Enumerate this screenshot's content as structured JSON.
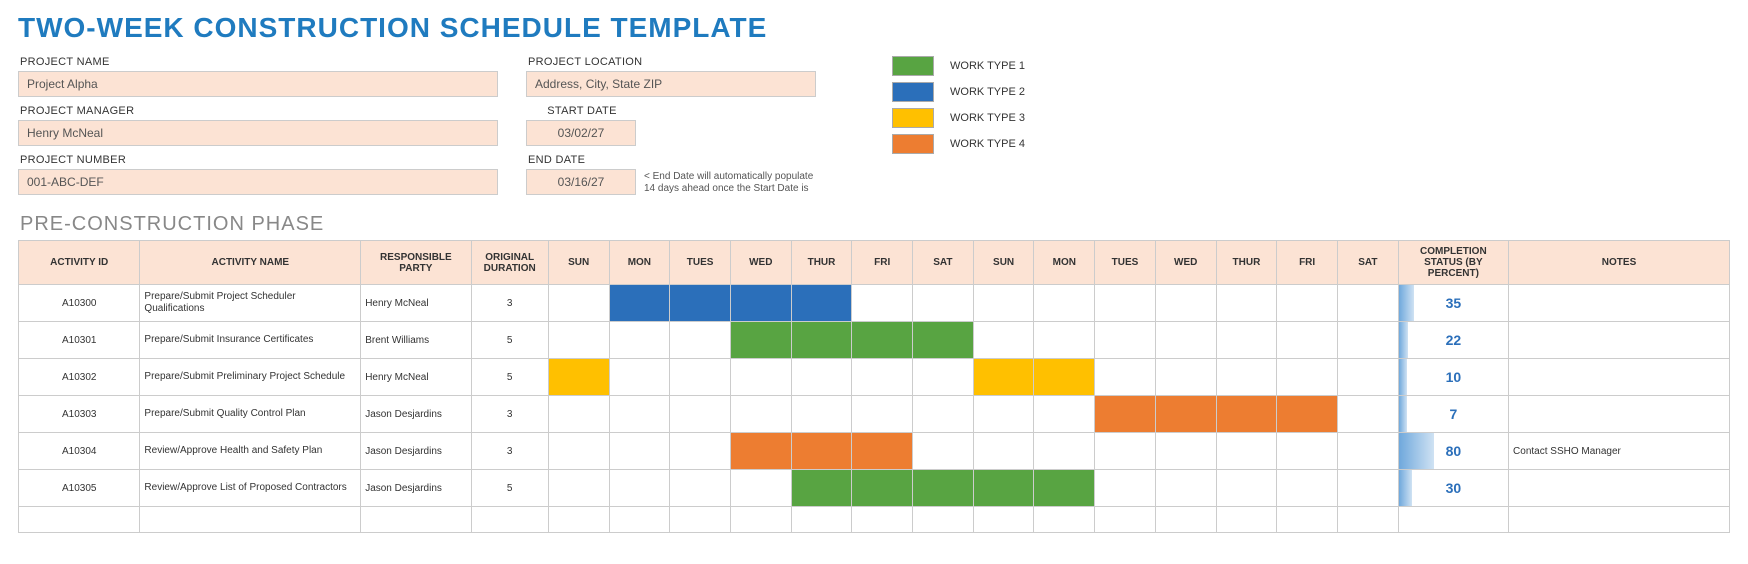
{
  "title": "TWO-WEEK CONSTRUCTION SCHEDULE TEMPLATE",
  "meta": {
    "project_name_label": "PROJECT NAME",
    "project_name": "Project Alpha",
    "project_manager_label": "PROJECT MANAGER",
    "project_manager": "Henry McNeal",
    "project_number_label": "PROJECT NUMBER",
    "project_number": "001-ABC-DEF",
    "project_location_label": "PROJECT LOCATION",
    "project_location": "Address, City, State ZIP",
    "start_date_label": "START DATE",
    "start_date": "03/02/27",
    "end_date_label": "END DATE",
    "end_date": "03/16/27",
    "end_date_hint": "< End Date will automatically populate 14 days ahead once the Start Date is"
  },
  "legend": [
    {
      "label": "WORK TYPE 1",
      "color": "#58a442"
    },
    {
      "label": "WORK TYPE 2",
      "color": "#2b6fba"
    },
    {
      "label": "WORK TYPE 3",
      "color": "#ffc000"
    },
    {
      "label": "WORK TYPE 4",
      "color": "#ed7d31"
    }
  ],
  "section_title": "PRE-CONSTRUCTION PHASE",
  "columns": {
    "activity_id": "ACTIVITY ID",
    "activity_name": "ACTIVITY NAME",
    "responsible_party": "RESPONSIBLE PARTY",
    "original_duration": "ORIGINAL DURATION",
    "days": [
      "SUN",
      "MON",
      "TUES",
      "WED",
      "THUR",
      "FRI",
      "SAT",
      "SUN",
      "MON",
      "TUES",
      "WED",
      "THUR",
      "FRI",
      "SAT"
    ],
    "completion": "COMPLETION STATUS (BY PERCENT)",
    "notes": "NOTES"
  },
  "rows": [
    {
      "id": "A10300",
      "name": "Prepare/Submit Project Scheduler Qualifications",
      "responsible": "Henry McNeal",
      "duration": "3",
      "fills": [
        "",
        "blue",
        "blue",
        "blue",
        "blue",
        "",
        "",
        "",
        "",
        "",
        "",
        "",
        "",
        ""
      ],
      "completion": 35,
      "notes": ""
    },
    {
      "id": "A10301",
      "name": "Prepare/Submit Insurance Certificates",
      "responsible": "Brent Williams",
      "duration": "5",
      "fills": [
        "",
        "",
        "",
        "green",
        "green",
        "green",
        "green",
        "",
        "",
        "",
        "",
        "",
        "",
        ""
      ],
      "completion": 22,
      "notes": ""
    },
    {
      "id": "A10302",
      "name": "Prepare/Submit Preliminary Project Schedule",
      "responsible": "Henry McNeal",
      "duration": "5",
      "fills": [
        "yellow",
        "",
        "",
        "",
        "",
        "",
        "",
        "yellow",
        "yellow",
        "",
        "",
        "",
        "",
        ""
      ],
      "completion": 10,
      "notes": ""
    },
    {
      "id": "A10303",
      "name": "Prepare/Submit Quality Control Plan",
      "responsible": "Jason Desjardins",
      "duration": "3",
      "fills": [
        "",
        "",
        "",
        "",
        "",
        "",
        "",
        "",
        "",
        "orange",
        "orange",
        "orange",
        "orange",
        ""
      ],
      "completion": 7,
      "notes": ""
    },
    {
      "id": "A10304",
      "name": "Review/Approve Health and Safety Plan",
      "responsible": "Jason Desjardins",
      "duration": "3",
      "fills": [
        "",
        "",
        "",
        "orange",
        "orange",
        "orange",
        "",
        "",
        "",
        "",
        "",
        "",
        "",
        ""
      ],
      "completion": 80,
      "notes": "Contact SSHO Manager"
    },
    {
      "id": "A10305",
      "name": "Review/Approve List of Proposed Contractors",
      "responsible": "Jason Desjardins",
      "duration": "5",
      "fills": [
        "",
        "",
        "",
        "",
        "green",
        "green",
        "green",
        "green",
        "green",
        "",
        "",
        "",
        "",
        ""
      ],
      "completion": 30,
      "notes": ""
    }
  ]
}
